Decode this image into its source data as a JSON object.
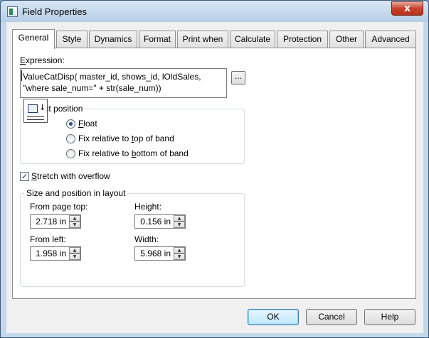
{
  "window": {
    "title": "Field Properties",
    "close_glyph": "x"
  },
  "tabs": [
    {
      "label": "General",
      "active": true
    },
    {
      "label": "Style"
    },
    {
      "label": "Dynamics"
    },
    {
      "label": "Format"
    },
    {
      "label": "Print when"
    },
    {
      "label": "Calculate"
    },
    {
      "label": "Protection"
    },
    {
      "label": "Other"
    },
    {
      "label": "Advanced"
    }
  ],
  "expression": {
    "label_accel": "E",
    "label_rest": "xpression:",
    "value": "ValueCatDisp( master_id, shows_id, lOldSales, \"where sale_num=\" + str(sale_num))",
    "browse_label": "..."
  },
  "object_position": {
    "title": "Object position",
    "options": [
      {
        "pre": "",
        "accel": "F",
        "post": "loat",
        "checked": true
      },
      {
        "pre": "Fix relative to ",
        "accel": "t",
        "post": "op of band",
        "checked": false
      },
      {
        "pre": "Fix relative to ",
        "accel": "b",
        "post": "ottom of band",
        "checked": false
      }
    ]
  },
  "stretch": {
    "accel": "S",
    "rest": "tretch with overflow",
    "checked": true,
    "check_glyph": "✓"
  },
  "size_position": {
    "title": "Size and position in layout",
    "from_page_top_label": "From page top:",
    "from_page_top_value": "2.718 in",
    "height_label": "Height:",
    "height_value": "0.156 in",
    "from_left_label": "From left:",
    "from_left_value": "1.958 in",
    "width_label": "Width:",
    "width_value": "5.968 in",
    "spin_up": "▲",
    "spin_down": "▼"
  },
  "buttons": {
    "ok": "OK",
    "cancel": "Cancel",
    "help": "Help"
  }
}
